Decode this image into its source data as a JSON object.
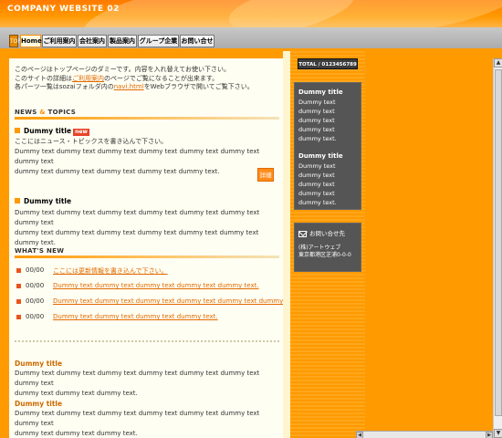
{
  "header": {
    "logo": "COMPANY WEBSITE 02"
  },
  "nav": {
    "home_icon": "TOP",
    "tabs": [
      "Home",
      "ご利用案内",
      "会社案内",
      "製品案内",
      "グループ企業",
      "お問い合せ"
    ]
  },
  "intro": {
    "line1": "このページはトップページのダミーです。内容を入れ替えてお使い下さい。",
    "line2_pre": "このサイトの詳細は",
    "line2_link": "ご利用案内",
    "line2_post": "のページでご覧になることが出来ます。",
    "line3_pre": "各パーツ一覧はsozaiフォルダ内の",
    "line3_link": "navi.html",
    "line3_post": "をWebブラウザで開いてご覧下さい。"
  },
  "news_topics": {
    "heading_news": "NEWS",
    "heading_amp": "&",
    "heading_topics": "TOPICS",
    "item1": {
      "title": "Dummy title",
      "badge": "new",
      "line1": "ここにはニュース・トピックスを書き込んで下さい。",
      "line2": "Dummy text dummy text dummy text dummy text dummy text dummy text dummy text",
      "line3": "dummy text dummy text dummy text dummy text dummy text.",
      "button": "詳細"
    },
    "item2": {
      "title": "Dummy title",
      "line1": "Dummy text dummy text dummy text dummy text dummy text dummy text dummy text",
      "line2": "dummy text dummy text dummy text dummy text dummy text dummy text dummy text."
    }
  },
  "whats_new": {
    "heading": "WHAT'S NEW",
    "rows": [
      {
        "date": "00/00",
        "text": "ここには更新情報を書き込んで下さい。"
      },
      {
        "date": "00/00",
        "text": "Dummy text dummy text dummy text dummy text dummy text."
      },
      {
        "date": "00/00",
        "text": "Dummy text dummy text dummy text dummy text dummy text dummy text."
      },
      {
        "date": "00/00",
        "text": "Dummy text dummy text dummy text dummy text."
      }
    ]
  },
  "bottom": {
    "block1": {
      "title": "Dummy title",
      "line1": "Dummy text dummy text dummy text dummy text dummy text dummy text dummy text",
      "line2": "dummy text dummy text dummy text."
    },
    "block2": {
      "title": "Dummy title",
      "line1": "Dummy text dummy text dummy text dummy text dummy text dummy text dummy text",
      "line2": "dummy text dummy text dummy text."
    }
  },
  "sidebar": {
    "total": "TOTAL / 0123456789",
    "panel": [
      {
        "title": "Dummy title",
        "text": "Dummy text dummy text dummy text dummy text dummy text."
      },
      {
        "title": "Dummy title",
        "text": "Dummy text dummy text dummy text dummy text dummy text."
      }
    ],
    "contact": {
      "heading": "お問い合せ先",
      "company": "(株)アートウェブ",
      "address": "東京都港区芝浦0-0-0"
    }
  },
  "colors": {
    "accent": "#ff9a00",
    "link": "#e06a00",
    "panel": "#555555"
  }
}
